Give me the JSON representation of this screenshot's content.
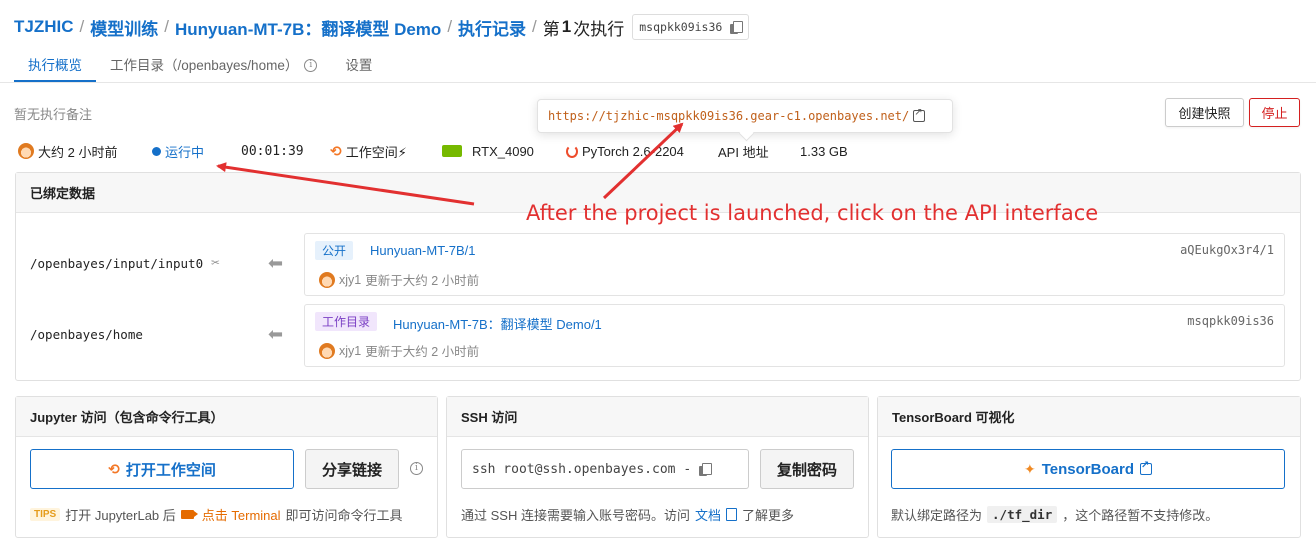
{
  "breadcrumb": {
    "org": "TJZHIC",
    "section": "模型训练",
    "project": "Hunyuan-MT-7B：翻译模型 Demo",
    "records": "执行记录",
    "current_pre": "第",
    "current_num": "1",
    "current_post": "次执行",
    "exec_id": "msqpkk09is36"
  },
  "tabs": [
    {
      "label": "执行概览",
      "active": true
    },
    {
      "label": "工作目录（/openbayes/home）"
    },
    {
      "label": "设置"
    }
  ],
  "note": "暂无执行备注",
  "url_popup": "https://tjzhic-msqpkk09is36.gear-c1.openbayes.net/",
  "actions": {
    "snapshot": "创建快照",
    "stop": "停止"
  },
  "status": {
    "age": "大约 2 小时前",
    "state": "运行中",
    "duration": "00:01:39",
    "workspace": "工作空间⚡",
    "gpu": "RTX_4090",
    "framework": "PyTorch 2.6-2204",
    "api": "API 地址",
    "size": "1.33 GB"
  },
  "bound_data": {
    "title": "已绑定数据",
    "rows": [
      {
        "path": "/openbayes/input/input0",
        "badge": "公开",
        "name": "Hunyuan-MT-7B/1",
        "id": "aQEukgOx3r4/1",
        "user": "xjy1",
        "updated": "更新于大约 2 小时前"
      },
      {
        "path": "/openbayes/home",
        "badge": "工作目录",
        "name": "Hunyuan-MT-7B：翻译模型 Demo/1",
        "id": "msqpkk09is36",
        "user": "xjy1",
        "updated": "更新于大约 2 小时前"
      }
    ]
  },
  "jupyter": {
    "title": "Jupyter 访问（包含命令行工具）",
    "open_label": "打开工作空间",
    "share_label": "分享链接",
    "tips_badge": "TIPS",
    "tips_pre": "打开 JupyterLab 后",
    "tips_click": "点击 Terminal",
    "tips_post": "即可访问命令行工具"
  },
  "ssh": {
    "title": "SSH 访问",
    "command": "ssh root@ssh.openbayes.com -",
    "copy_password": "复制密码",
    "desc_pre": "通过 SSH 连接需要输入账号密码。访问",
    "desc_link": "文档",
    "desc_post": "了解更多"
  },
  "tensorboard": {
    "title": "TensorBoard 可视化",
    "button": "TensorBoard",
    "desc_pre": "默认绑定路径为",
    "desc_code": "./tf_dir",
    "desc_post": "，这个路径暂不支持修改。"
  },
  "annotation": "After the project is launched, click on the API interface",
  "colors": {
    "link": "#1570c9",
    "stop": "#d42020",
    "annotation": "#e23030"
  }
}
